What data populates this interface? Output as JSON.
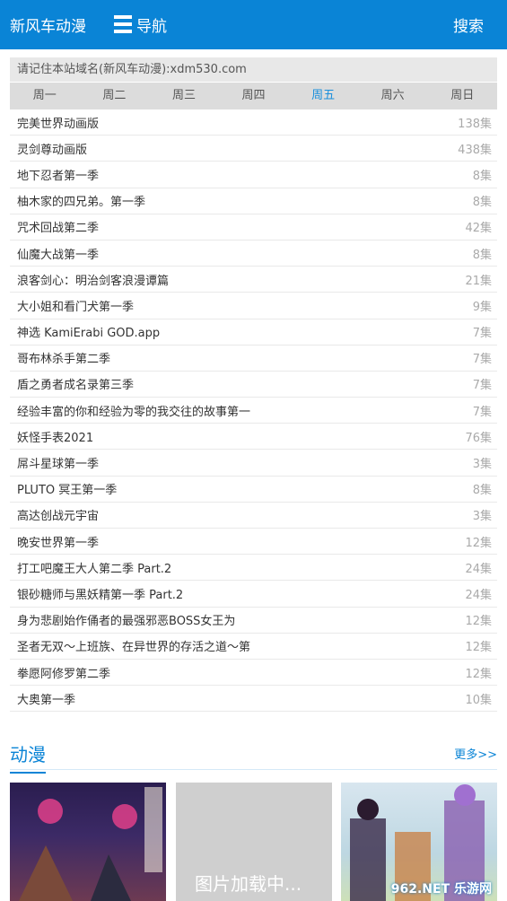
{
  "header": {
    "brand": "新风车动漫",
    "nav_label": "导航",
    "search_label": "搜索"
  },
  "notice": "请记住本站域名(新风车动漫):xdm530.com",
  "weekday_tabs": [
    "周一",
    "周二",
    "周三",
    "周四",
    "周五",
    "周六",
    "周日"
  ],
  "active_tab": "周五",
  "schedule": [
    {
      "title": "完美世界动画版",
      "count": "138集"
    },
    {
      "title": "灵剑尊动画版",
      "count": "438集"
    },
    {
      "title": "地下忍者第一季",
      "count": "8集"
    },
    {
      "title": "柚木家的四兄弟。第一季",
      "count": "8集"
    },
    {
      "title": "咒术回战第二季",
      "count": "42集"
    },
    {
      "title": "仙魔大战第一季",
      "count": "8集"
    },
    {
      "title": "浪客剑心：明治剑客浪漫谭篇",
      "count": "21集"
    },
    {
      "title": "大小姐和看门犬第一季",
      "count": "9集"
    },
    {
      "title": "神选 KamiErabi GOD.app",
      "count": "7集"
    },
    {
      "title": "哥布林杀手第二季",
      "count": "7集"
    },
    {
      "title": "盾之勇者成名录第三季",
      "count": "7集"
    },
    {
      "title": "经验丰富的你和经验为零的我交往的故事第一",
      "count": "7集"
    },
    {
      "title": "妖怪手表2021",
      "count": "76集"
    },
    {
      "title": "屌斗星球第一季",
      "count": "3集"
    },
    {
      "title": "PLUTO 冥王第一季",
      "count": "8集"
    },
    {
      "title": "高达创战元宇宙",
      "count": "3集"
    },
    {
      "title": "晚安世界第一季",
      "count": "12集"
    },
    {
      "title": "打工吧魔王大人第二季 Part.2",
      "count": "24集"
    },
    {
      "title": "银砂糖师与黑妖精第一季 Part.2",
      "count": "24集"
    },
    {
      "title": "身为悲剧始作俑者的最强邪恶BOSS女王为",
      "count": "12集"
    },
    {
      "title": "圣者无双～上班族、在异世界的存活之道～第",
      "count": "12集"
    },
    {
      "title": "拳愿阿修罗第二季",
      "count": "12集"
    },
    {
      "title": "大奥第一季",
      "count": "10集"
    }
  ],
  "section": {
    "title": "动漫",
    "more": "更多>>"
  },
  "cards": {
    "loading_text": "图片加载中...",
    "watermark": "962.NET 乐游网"
  }
}
